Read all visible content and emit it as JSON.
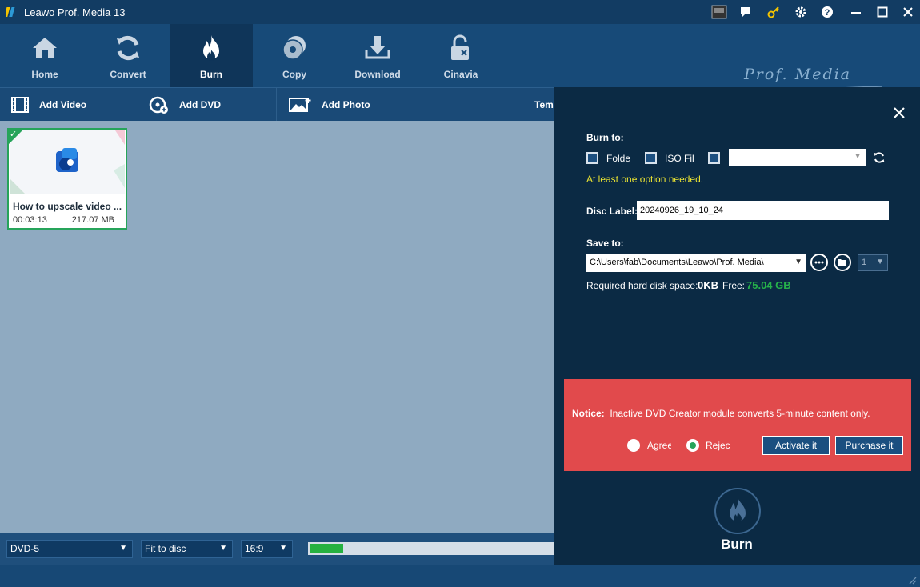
{
  "window": {
    "title": "Leawo Prof. Media 13"
  },
  "nav": {
    "items": [
      {
        "label": "Home"
      },
      {
        "label": "Convert"
      },
      {
        "label": "Burn"
      },
      {
        "label": "Copy"
      },
      {
        "label": "Download"
      },
      {
        "label": "Cinavia"
      }
    ],
    "active": "Burn",
    "brand": "Prof. Media"
  },
  "toolbar": {
    "add_video": "Add Video",
    "add_dvd": "Add DVD",
    "add_photo": "Add Photo",
    "template": "Tem"
  },
  "video_card": {
    "title": "How to upscale video ...",
    "duration": "00:03:13",
    "size": "217.07 MB",
    "selected": true
  },
  "bottom": {
    "disc_type": "DVD-5",
    "fit": "Fit to disc",
    "aspect": "16:9",
    "progress_fraction": 0.14
  },
  "panel": {
    "burn_to_label": "Burn to:",
    "options": [
      {
        "label": "Folde",
        "checked": false
      },
      {
        "label": "ISO File",
        "checked": false
      },
      {
        "label": "",
        "checked": false
      }
    ],
    "drive_value": "",
    "warning": "At least one option needed.",
    "disc_label_label": "Disc Label:",
    "disc_label_value": "20240926_19_10_24",
    "save_to_label": "Save to:",
    "save_to_value": "C:\\Users\\fab\\Documents\\Leawo\\Prof. Media\\",
    "copies_value": "1",
    "required_label": "Required hard disk space:",
    "required_value": "0KB",
    "free_label": "Free:",
    "free_value": "75.04 GB",
    "free_color": "#26b14a"
  },
  "notice": {
    "title": "Notice:",
    "text": "Inactive DVD Creator module converts 5-minute content only.",
    "agree_label": "Agree",
    "reject_label": "Reject",
    "selected": "Reject",
    "activate_label": "Activate it",
    "purchase_label": "Purchase it",
    "background": "#e14a4c"
  },
  "burn_button": {
    "label": "Burn"
  }
}
